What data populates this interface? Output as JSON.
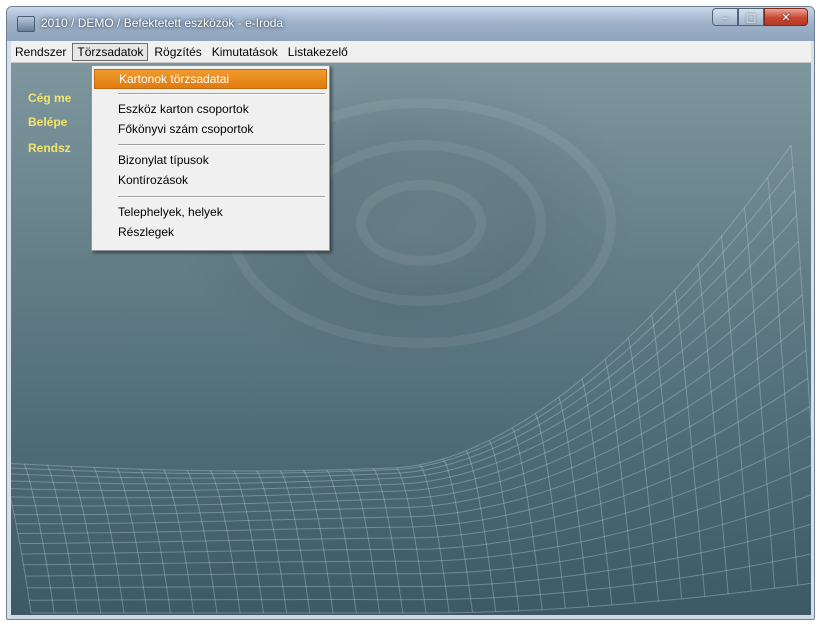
{
  "window": {
    "title": "2010 / DEMO / Befektetett eszközök - e-Iroda",
    "controls": {
      "minimize": "–",
      "maximize": "□",
      "close": "✕"
    }
  },
  "menubar": {
    "items": [
      {
        "label": "Rendszer"
      },
      {
        "label": "Törzsadatok"
      },
      {
        "label": "Rögzítés"
      },
      {
        "label": "Kimutatások"
      },
      {
        "label": "Listakezelő"
      }
    ]
  },
  "dropdown": {
    "items": [
      {
        "label": "Kartonok törzsadatai"
      },
      {
        "label": "Eszköz karton csoportok"
      },
      {
        "label": "Főkönyvi szám csoportok"
      },
      {
        "label": "Bizonylat típusok"
      },
      {
        "label": "Kontírozások"
      },
      {
        "label": "Telephelyek, helyek"
      },
      {
        "label": "Részlegek"
      }
    ]
  },
  "info": {
    "line1": "Cég me",
    "line2": "Belépe",
    "line3": "Rendsz"
  },
  "colors": {
    "highlight": "#e8870f",
    "info_text": "#f3e56b",
    "background": "#5f7a83"
  }
}
